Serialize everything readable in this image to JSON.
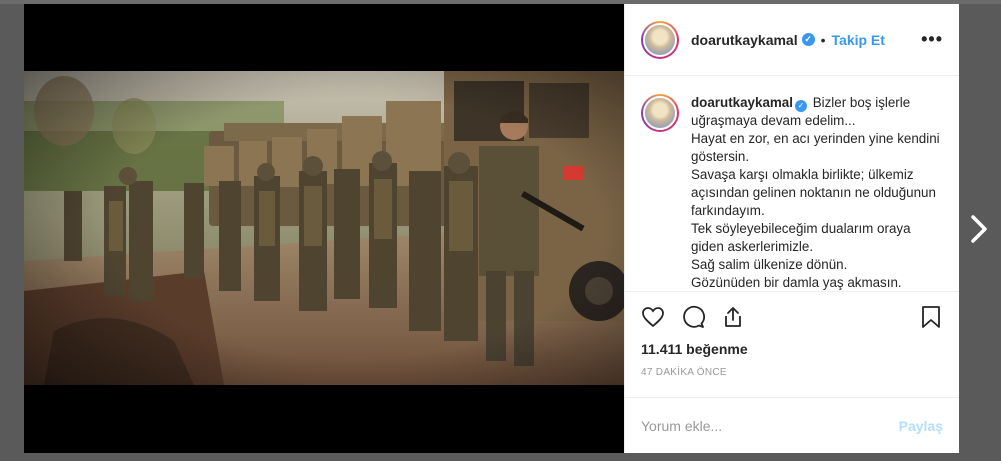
{
  "post": {
    "username": "doarutkaykamal",
    "verified_icon": "verified-badge-icon",
    "separator": "•",
    "follow_label": "Takip Et",
    "more_label": "•••",
    "caption_username": "doarutkaykamal",
    "caption": "Bizler boş işlerle uğraşmaya devam edelim...\nHayat en zor, en acı yerinden yine kendini göstersin.\nSavaşa karşı olmakla birlikte; ülkemiz açısından gelinen noktanın ne olduğunun farkındayım.\nTek söyleyebileceğim dualarım oraya giden askerlerimizle.\nSağ salim ülkenize dönün.\nGözünüden bir damla yaş akmasın.",
    "likes": "11.411 beğenme",
    "time": "47 DAKİKA ÖNCE",
    "comment_placeholder": "Yorum ekle...",
    "share_label": "Paylaş"
  },
  "icons": {
    "like": "heart-icon",
    "comment": "comment-icon",
    "share": "share-icon",
    "save": "bookmark-icon",
    "next": "chevron-right-icon"
  },
  "colors": {
    "accent": "#3897f0",
    "share_disabled": "#b2dffc",
    "text": "#262626",
    "muted": "#999999"
  }
}
